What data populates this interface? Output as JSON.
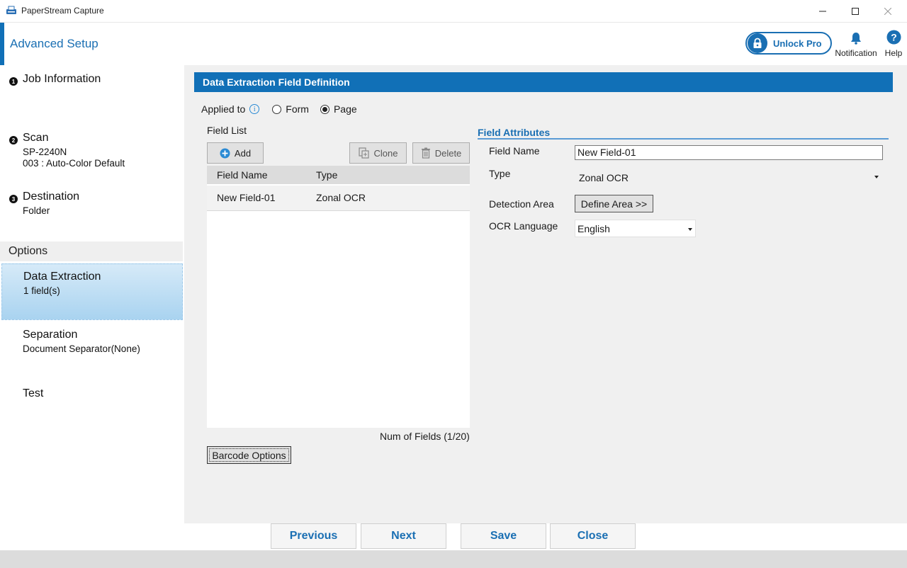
{
  "window": {
    "title": "PaperStream Capture"
  },
  "header": {
    "title": "Advanced Setup",
    "unlock_label": "Unlock Pro",
    "notification_label": "Notification",
    "help_label": "Help"
  },
  "sidebar": {
    "steps": [
      {
        "num": "1",
        "title": "Job Information",
        "lines": []
      },
      {
        "num": "2",
        "title": "Scan",
        "lines": [
          "SP-2240N",
          "003 : Auto-Color Default"
        ]
      },
      {
        "num": "3",
        "title": "Destination",
        "lines": [
          "Folder"
        ]
      }
    ],
    "options_header": "Options",
    "options": [
      {
        "title": "Data Extraction",
        "sub": "1 field(s)",
        "active": true
      },
      {
        "title": "Separation",
        "sub": "Document Separator(None)",
        "active": false
      },
      {
        "title": "Test",
        "sub": "",
        "active": false
      }
    ]
  },
  "main": {
    "section_title": "Data Extraction Field Definition",
    "applied_to_label": "Applied to",
    "applied_options": [
      "Form",
      "Page"
    ],
    "applied_selected": "Page",
    "field_list_label": "Field List",
    "add_label": "Add",
    "clone_label": "Clone",
    "delete_label": "Delete",
    "columns": [
      "Field Name",
      "Type"
    ],
    "rows": [
      {
        "name": "New Field-01",
        "type": "Zonal OCR"
      }
    ],
    "num_fields": "Num of Fields (1/20)",
    "barcode_options_label": "Barcode Options"
  },
  "attributes": {
    "title": "Field Attributes",
    "field_name_label": "Field Name",
    "field_name_value": "New Field-01",
    "type_label": "Type",
    "type_value": "Zonal OCR",
    "detection_label": "Detection Area",
    "define_area_label": "Define Area >>",
    "ocr_language_label": "OCR Language",
    "ocr_language_value": "English"
  },
  "footer": {
    "previous": "Previous",
    "next": "Next",
    "save": "Save",
    "close": "Close"
  },
  "colors": {
    "accent": "#1170b7",
    "link_blue": "#1a6fb3",
    "active_item": "#a9d3f0"
  }
}
